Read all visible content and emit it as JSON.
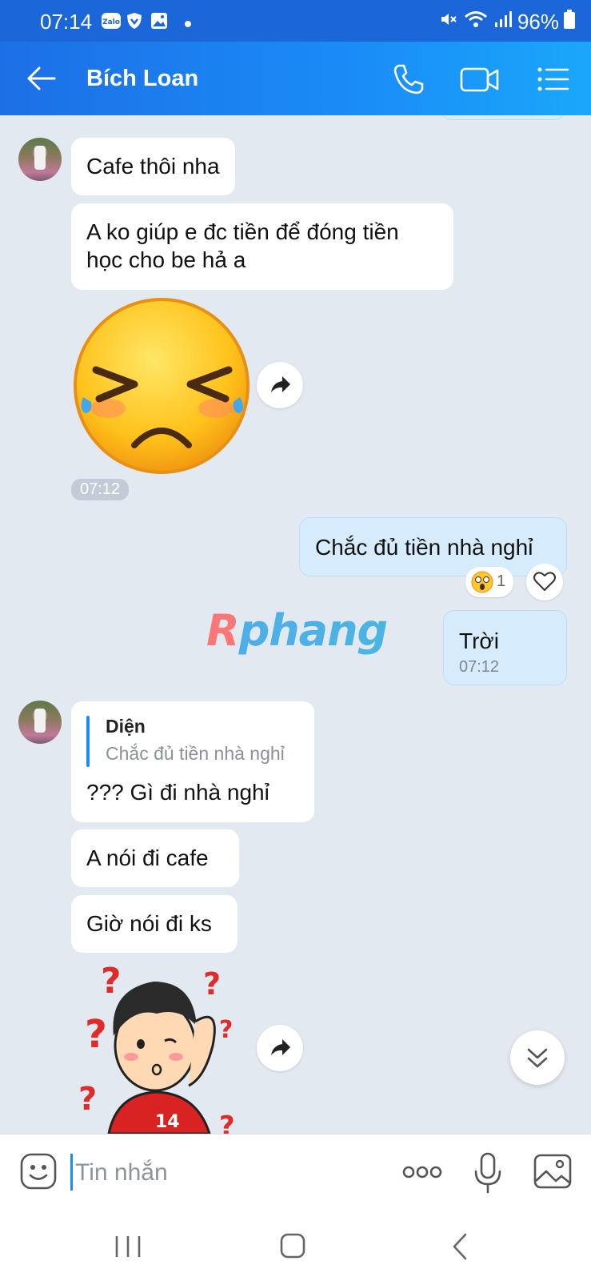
{
  "status_bar": {
    "time": "07:14",
    "app_icons": [
      "zalo-icon",
      "vpn-shield-icon",
      "gallery-icon",
      "dot-icon"
    ],
    "battery": "96%",
    "system_icons": [
      "mute-icon",
      "wifi-icon",
      "signal-icon",
      "battery-icon"
    ]
  },
  "header": {
    "contact_name": "Bích Loan",
    "actions": [
      "phone-call-icon",
      "video-call-icon",
      "menu-list-icon"
    ],
    "color_start": "#1d6fe6",
    "color_end": "#1aa7fa"
  },
  "messages": [
    {
      "side": "in",
      "type": "text",
      "text": "Cafe thôi nha"
    },
    {
      "side": "in",
      "type": "text",
      "text": "A ko giúp e đc tiền để đóng tiền học cho be hả a"
    },
    {
      "side": "in",
      "type": "sticker",
      "sticker": "crying-angry-emoji-sticker",
      "time": "07:12"
    },
    {
      "side": "out",
      "type": "text",
      "text": "Chắc đủ tiền nhà nghỉ",
      "reaction_count": "1"
    },
    {
      "side": "out",
      "type": "text",
      "text": "Trời",
      "time": "07:12"
    },
    {
      "side": "in",
      "type": "reply",
      "quote_author": "Diện",
      "quote_text": "Chắc đủ tiền nhà nghỉ",
      "text": "??? Gì đi nhà nghỉ"
    },
    {
      "side": "in",
      "type": "text",
      "text": "A nói đi cafe"
    },
    {
      "side": "in",
      "type": "text",
      "text": "Giờ nói đi ks"
    },
    {
      "side": "in",
      "type": "sticker",
      "sticker": "confused-boy-sticker"
    }
  ],
  "watermark": "Rphang",
  "input": {
    "placeholder": "Tin nhắn",
    "actions": [
      "emoji-icon",
      "more-options-icon",
      "microphone-icon",
      "image-icon"
    ]
  },
  "nav": [
    "recent-apps-icon",
    "home-icon",
    "back-icon"
  ],
  "colors": {
    "chat_background": "#e3e9f0",
    "my_bubble": "#d6ecfc",
    "their_bubble": "#ffffff",
    "accent": "#1a8cf7"
  }
}
